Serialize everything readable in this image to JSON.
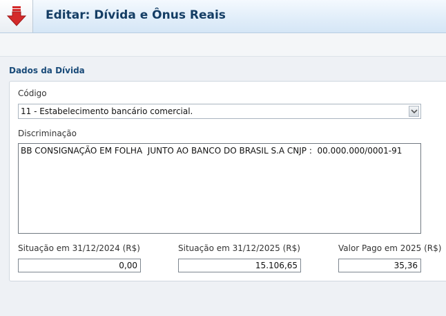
{
  "header": {
    "title": "Editar: Dívida e Ônus Reais",
    "icon": "download-arrow-icon"
  },
  "section": {
    "title": "Dados da Dívida"
  },
  "form": {
    "codigo_label": "Código",
    "codigo_value": "11 - Estabelecimento bancário comercial.",
    "discriminacao_label": "Discriminação",
    "discriminacao_value": "BB CONSIGNAÇÃO EM FOLHA  JUNTO AO BANCO DO BRASIL S.A CNJP :  00.000.000/0001-91",
    "situacao_2024_label": "Situação em 31/12/2024 (R$)",
    "situacao_2024_value": "0,00",
    "situacao_2025_label": "Situação em 31/12/2025 (R$)",
    "situacao_2025_value": "15.106,65",
    "valor_pago_label": "Valor Pago em 2025 (R$)",
    "valor_pago_value": "35,36"
  },
  "colors": {
    "title": "#143d64",
    "section_title": "#1a4b79",
    "icon_red": "#d42a2a"
  }
}
